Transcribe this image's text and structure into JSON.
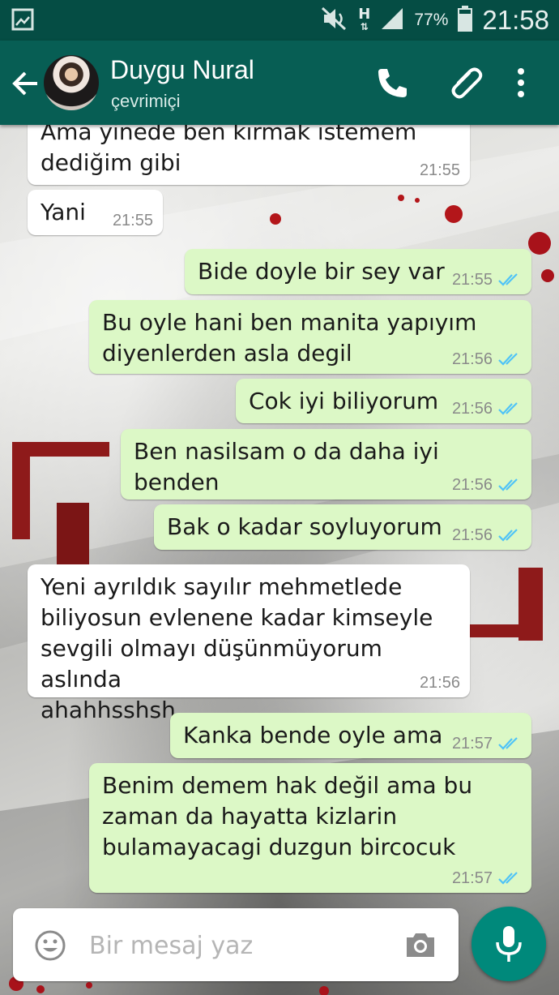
{
  "status_bar": {
    "battery_percent": "77%",
    "time": "21:58",
    "network": "H",
    "icons": [
      "gallery-icon",
      "mute-icon",
      "network-h-icon",
      "signal-icon",
      "battery-icon"
    ]
  },
  "header": {
    "contact_name": "Duygu Nural",
    "contact_status": "çevrimiçi",
    "icons": [
      "back-arrow-icon",
      "phone-icon",
      "paperclip-icon",
      "more-vert-icon"
    ]
  },
  "messages": [
    {
      "dir": "in",
      "text": "Ama yinede ben kırmak istemem\ndediğim gibi",
      "time": "21:55"
    },
    {
      "dir": "in",
      "text": "Yani",
      "time": "21:55"
    },
    {
      "dir": "out",
      "text": "Bide doyle bir sey var",
      "time": "21:55",
      "status": "read"
    },
    {
      "dir": "out",
      "text": "Bu oyle hani ben manita yapıyım\ndiyenlerden asla degil",
      "time": "21:56",
      "status": "read"
    },
    {
      "dir": "out",
      "text": "Cok iyi biliyorum",
      "time": "21:56",
      "status": "read"
    },
    {
      "dir": "out",
      "text": "Ben nasilsam o da daha iyi benden",
      "time": "21:56",
      "status": "read"
    },
    {
      "dir": "out",
      "text": "Bak o kadar soyluyorum",
      "time": "21:56",
      "status": "read"
    },
    {
      "dir": "in",
      "text": "Yeni ayrıldık sayılır mehmetlede\nbiliyosun evlenene kadar kimseyle\nsevgili olmayı düşünmüyorum aslında\nahahhsshsh",
      "time": "21:56"
    },
    {
      "dir": "out",
      "text": "Kanka bende oyle ama",
      "time": "21:57",
      "status": "read"
    },
    {
      "dir": "out",
      "text": "Benim demem hak değil ama bu\nzaman da hayatta kizlarin\nbulamayacagi duzgun bircocuk",
      "time": "21:57",
      "status": "read"
    }
  ],
  "composer": {
    "placeholder": "Bir mesaj yaz",
    "value": "",
    "icons": [
      "emoji-icon",
      "camera-icon",
      "microphone-icon"
    ]
  },
  "colors": {
    "status_bar": "#054d44",
    "app_bar": "#075e54",
    "outgoing_bubble": "#dcf8c6",
    "incoming_bubble": "#ffffff",
    "read_ticks": "#4fc3f7",
    "mic_button": "#00897b"
  }
}
